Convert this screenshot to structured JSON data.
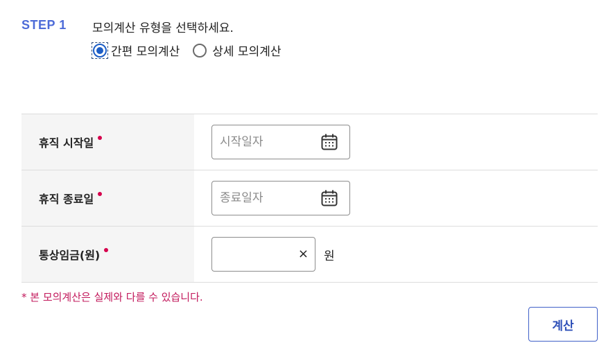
{
  "step": {
    "label": "STEP 1",
    "title": "모의계산 유형을 선택하세요."
  },
  "calc_type": {
    "options": [
      {
        "label": "간편 모의계산",
        "checked": true
      },
      {
        "label": "상세 모의계산",
        "checked": false
      }
    ]
  },
  "form": {
    "leave_start": {
      "label": "휴직 시작일",
      "placeholder": "시작일자",
      "icon": "calendar-icon"
    },
    "leave_end": {
      "label": "휴직 종료일",
      "placeholder": "종료일자",
      "icon": "calendar-icon"
    },
    "wage": {
      "label": "통상임금(원)",
      "value": "",
      "clear_glyph": "×",
      "unit": "원"
    },
    "required_color": "#d6004c"
  },
  "notice": "* 본 모의계산은 실제와 다를 수 있습니다.",
  "actions": {
    "calculate_label": "계산"
  },
  "colors": {
    "accent": "#4d6bd8",
    "radio_checked": "#1d5ec6",
    "notice": "#c2185b"
  }
}
